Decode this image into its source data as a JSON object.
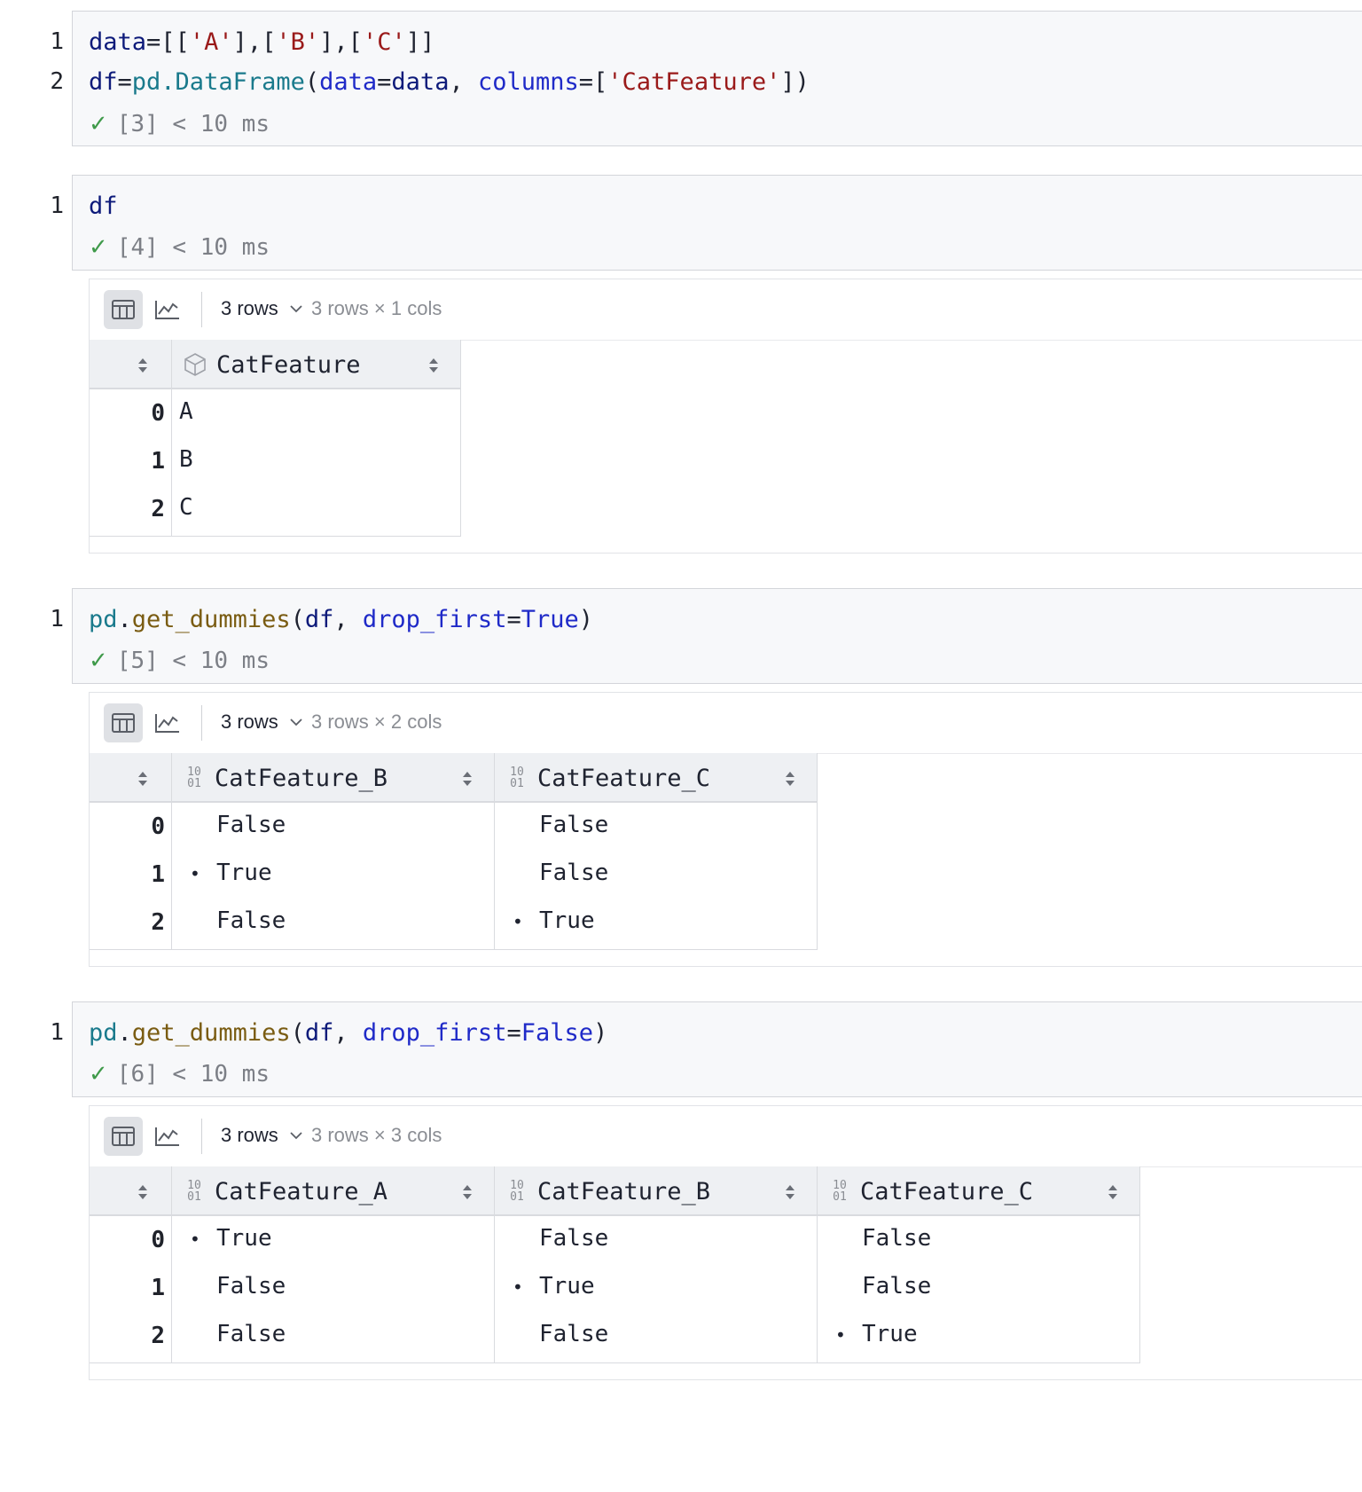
{
  "cells": [
    {
      "lines": [
        {
          "num": "1",
          "tokens": [
            [
              "data",
              ""
            ],
            [
              "=[[",
              "op"
            ],
            [
              "'A'",
              "str"
            ],
            [
              "],[",
              "op"
            ],
            [
              "'B'",
              "str"
            ],
            [
              "],[",
              "op"
            ],
            [
              "'C'",
              "str"
            ],
            [
              "]]",
              "op"
            ]
          ]
        },
        {
          "num": "2",
          "tokens": [
            [
              "df",
              ""
            ],
            [
              "=",
              "op"
            ],
            [
              "pd",
              "mod"
            ],
            [
              ".DataFrame",
              "mod"
            ],
            [
              "(",
              "op"
            ],
            [
              "data",
              "kw"
            ],
            [
              "=",
              "op"
            ],
            [
              "data",
              ""
            ],
            [
              ", ",
              "op"
            ],
            [
              "columns",
              "kw"
            ],
            [
              "=[",
              "op"
            ],
            [
              "'CatFeature'",
              "str"
            ],
            [
              "])",
              "op"
            ]
          ]
        }
      ],
      "status": "[3] < 10 ms"
    },
    {
      "lines": [
        {
          "num": "1",
          "tokens": [
            [
              "df",
              ""
            ]
          ]
        }
      ],
      "status": "[4] < 10 ms"
    },
    {
      "lines": [
        {
          "num": "1",
          "tokens": [
            [
              "pd",
              "mod"
            ],
            [
              ".",
              "op"
            ],
            [
              "get_dummies",
              "fn"
            ],
            [
              "(",
              "op"
            ],
            [
              "df",
              ""
            ],
            [
              ", ",
              "op"
            ],
            [
              "drop_first",
              "kw"
            ],
            [
              "=",
              "op"
            ],
            [
              "True",
              "kw"
            ],
            [
              ")",
              "op"
            ]
          ]
        }
      ],
      "status": "[5] < 10 ms"
    },
    {
      "lines": [
        {
          "num": "1",
          "tokens": [
            [
              "pd",
              "mod"
            ],
            [
              ".",
              "op"
            ],
            [
              "get_dummies",
              "fn"
            ],
            [
              "(",
              "op"
            ],
            [
              "df",
              ""
            ],
            [
              ", ",
              "op"
            ],
            [
              "drop_first",
              "kw"
            ],
            [
              "=",
              "op"
            ],
            [
              "False",
              "kw"
            ],
            [
              ")",
              "op"
            ]
          ]
        }
      ],
      "status": "[6] < 10 ms"
    }
  ],
  "outputs": [
    {
      "rows_label": "3 rows",
      "shape": "3 rows × 1 cols",
      "columns": [
        {
          "name": "CatFeature",
          "type_icon": "cube-icon"
        }
      ],
      "index": [
        "0",
        "1",
        "2"
      ],
      "rows": [
        [
          "A"
        ],
        [
          "B"
        ],
        [
          "C"
        ]
      ],
      "flags": [
        [
          false
        ],
        [
          false
        ],
        [
          false
        ]
      ]
    },
    {
      "rows_label": "3 rows",
      "shape": "3 rows × 2 cols",
      "columns": [
        {
          "name": "CatFeature_B",
          "type_icon": "binary-icon"
        },
        {
          "name": "CatFeature_C",
          "type_icon": "binary-icon"
        }
      ],
      "index": [
        "0",
        "1",
        "2"
      ],
      "rows": [
        [
          "False",
          "False"
        ],
        [
          "True",
          "False"
        ],
        [
          "False",
          "True"
        ]
      ],
      "flags": [
        [
          false,
          false
        ],
        [
          true,
          false
        ],
        [
          false,
          true
        ]
      ]
    },
    {
      "rows_label": "3 rows",
      "shape": "3 rows × 3 cols",
      "columns": [
        {
          "name": "CatFeature_A",
          "type_icon": "binary-icon"
        },
        {
          "name": "CatFeature_B",
          "type_icon": "binary-icon"
        },
        {
          "name": "CatFeature_C",
          "type_icon": "binary-icon"
        }
      ],
      "index": [
        "0",
        "1",
        "2"
      ],
      "rows": [
        [
          "True",
          "False",
          "False"
        ],
        [
          "False",
          "True",
          "False"
        ],
        [
          "False",
          "False",
          "True"
        ]
      ],
      "flags": [
        [
          true,
          false,
          false
        ],
        [
          false,
          true,
          false
        ],
        [
          false,
          false,
          true
        ]
      ]
    }
  ],
  "binary_icon_text": {
    "top": "10",
    "bottom": "01"
  },
  "colors": {
    "check": "#3f9a4a",
    "string": "#9a1a1a",
    "keyword": "#1f2ac8",
    "module": "#1a7a8c",
    "function": "#7a5c12"
  }
}
